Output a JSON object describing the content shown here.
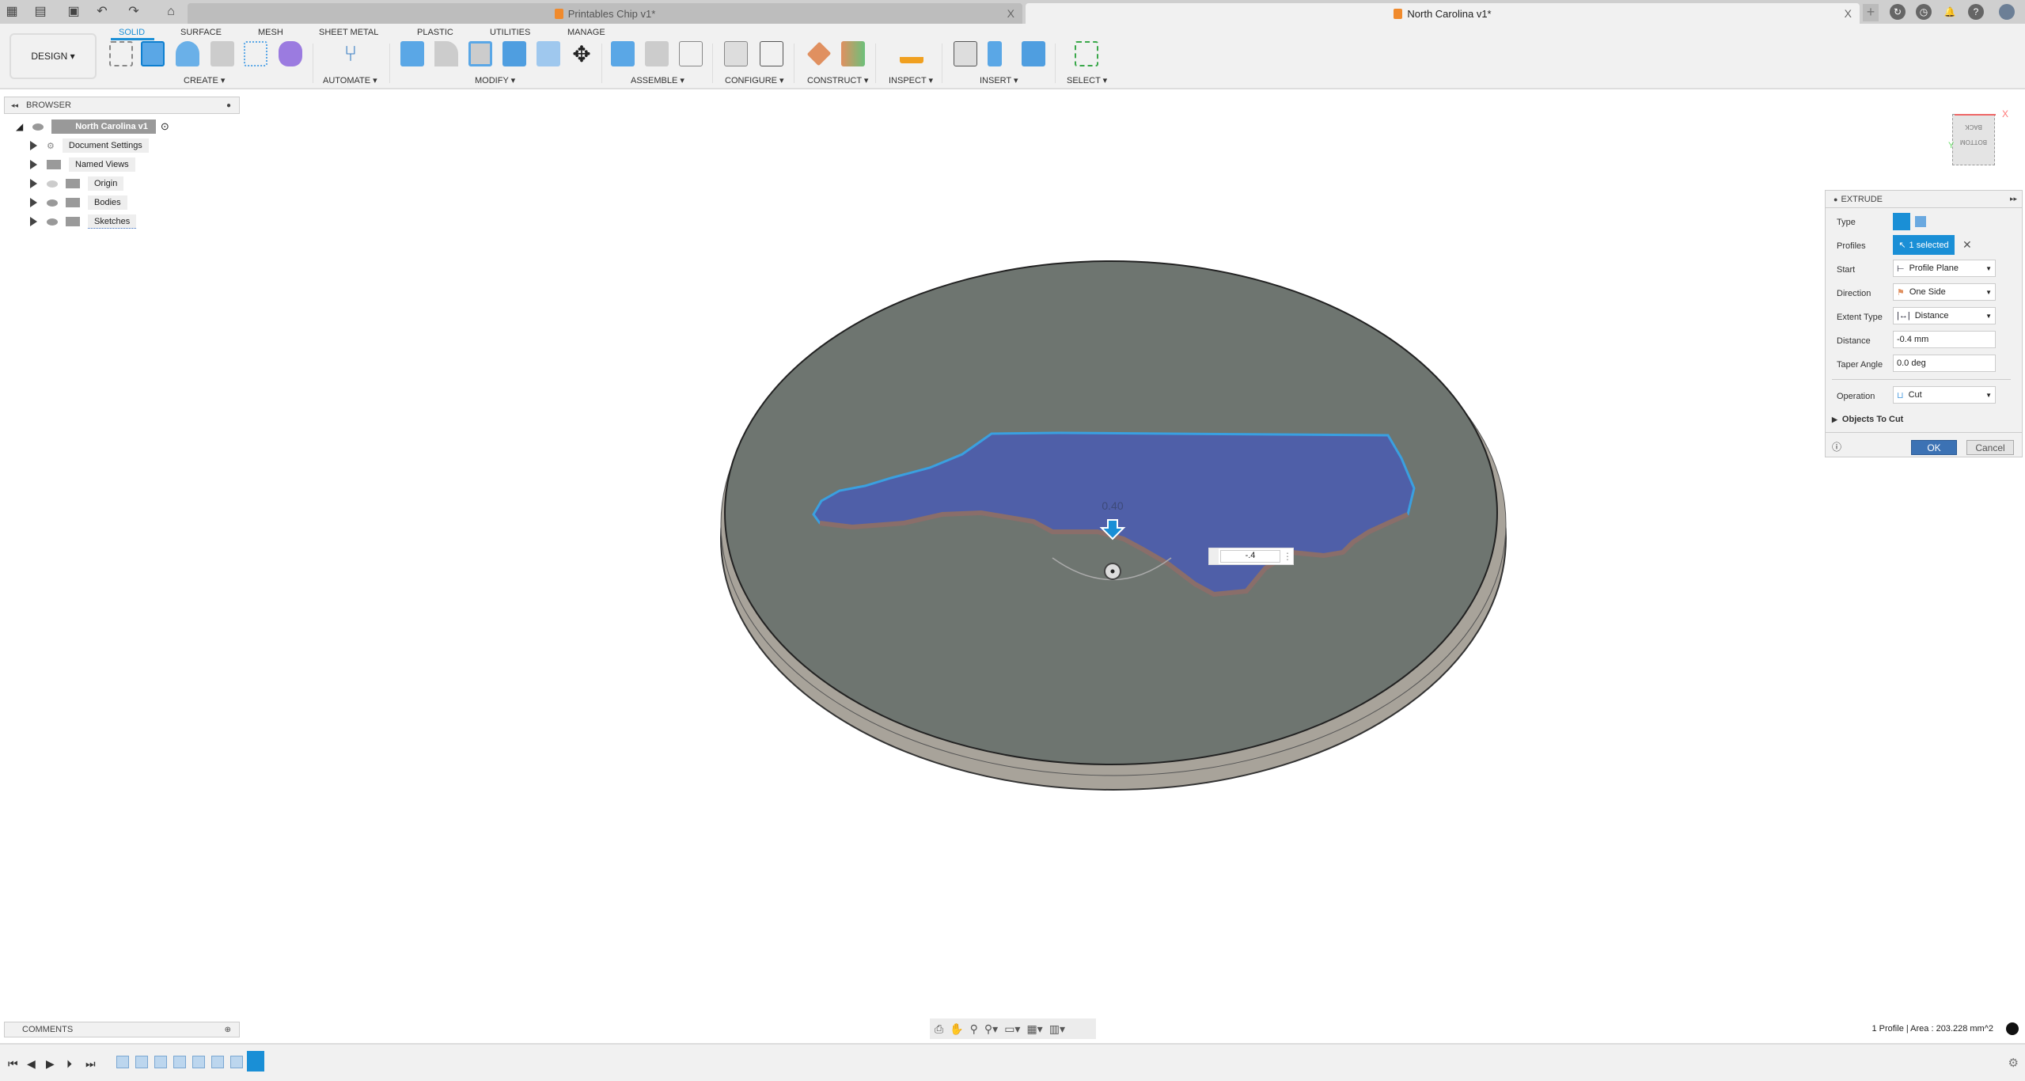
{
  "title_bar": {
    "tabs": [
      {
        "label": "Printables Chip v1*",
        "active": false
      },
      {
        "label": "North Carolina v1*",
        "active": true
      }
    ],
    "close": "X",
    "new_tab": "+"
  },
  "toolbar": {
    "workspace": "DESIGN ▾",
    "tabs": [
      "SOLID",
      "SURFACE",
      "MESH",
      "SHEET METAL",
      "PLASTIC",
      "UTILITIES",
      "MANAGE"
    ],
    "groups": [
      "CREATE ▾",
      "AUTOMATE ▾",
      "MODIFY ▾",
      "ASSEMBLE ▾",
      "CONFIGURE ▾",
      "CONSTRUCT ▾",
      "INSPECT ▾",
      "INSERT ▾",
      "SELECT ▾"
    ],
    "accent": "#1a8fd6"
  },
  "browser": {
    "title": "BROWSER",
    "root": "North Carolina v1",
    "items": [
      "Document Settings",
      "Named Views",
      "Origin",
      "Bodies",
      "Sketches"
    ]
  },
  "extrude": {
    "title": "EXTRUDE",
    "type_label": "Type",
    "profiles_label": "Profiles",
    "profiles_value": "1 selected",
    "start_label": "Start",
    "start_value": "Profile Plane",
    "direction_label": "Direction",
    "direction_value": "One Side",
    "extent_label": "Extent Type",
    "extent_value": "Distance",
    "distance_label": "Distance",
    "distance_value": "-0.4 mm",
    "taper_label": "Taper Angle",
    "taper_value": "0.0 deg",
    "operation_label": "Operation",
    "operation_value": "Cut",
    "objects_label": "Objects To Cut",
    "ok": "OK",
    "cancel": "Cancel"
  },
  "viewport": {
    "dimension_label": "0.40",
    "input_value": "-.4",
    "viewcube": {
      "top": "BOTTOM",
      "front": "BACK",
      "x": "X",
      "y": "Y"
    },
    "colors": {
      "profile": "#4f5fa8",
      "face": "#6e7570",
      "side": "#a8a39a"
    }
  },
  "comments": {
    "title": "COMMENTS"
  },
  "status": {
    "text": "1 Profile | Area : 203.228 mm^2"
  }
}
